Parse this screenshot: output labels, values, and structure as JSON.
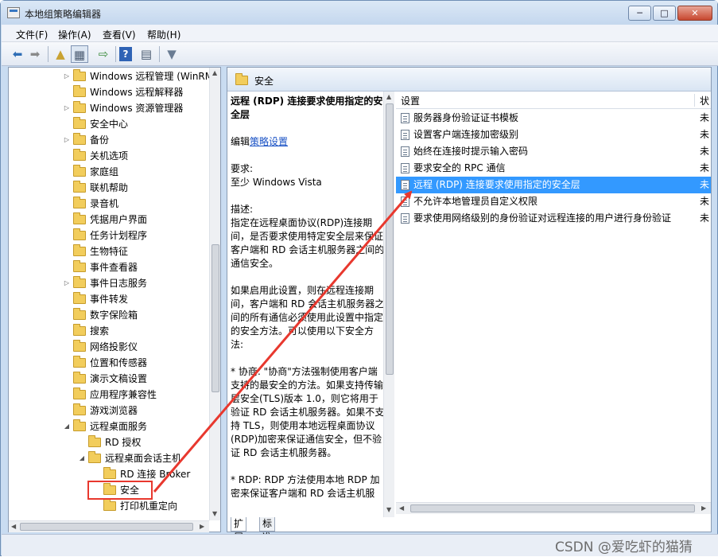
{
  "window": {
    "title": "本地组策略编辑器",
    "buttons": [
      "─",
      "□",
      "✕"
    ]
  },
  "menu": [
    "文件(F)",
    "操作(A)",
    "查看(V)",
    "帮助(H)"
  ],
  "toolbar_icons": [
    "back-arrow-icon",
    "forward-arrow-icon",
    "up-folder-icon",
    "show-hide-tree-icon",
    "export-list-icon",
    "help-icon",
    "properties-icon",
    "filter-icon"
  ],
  "tree": {
    "items": [
      {
        "label": "Windows 远程管理 (WinRM",
        "level": 1,
        "expandable": true
      },
      {
        "label": "Windows 远程解释器",
        "level": 1,
        "expandable": false
      },
      {
        "label": "Windows 资源管理器",
        "level": 1,
        "expandable": true
      },
      {
        "label": "安全中心",
        "level": 1,
        "expandable": false
      },
      {
        "label": "备份",
        "level": 1,
        "expandable": true
      },
      {
        "label": "关机选项",
        "level": 1,
        "expandable": false
      },
      {
        "label": "家庭组",
        "level": 1,
        "expandable": false
      },
      {
        "label": "联机帮助",
        "level": 1,
        "expandable": false
      },
      {
        "label": "录音机",
        "level": 1,
        "expandable": false
      },
      {
        "label": "凭据用户界面",
        "level": 1,
        "expandable": false
      },
      {
        "label": "任务计划程序",
        "level": 1,
        "expandable": false
      },
      {
        "label": "生物特征",
        "level": 1,
        "expandable": false
      },
      {
        "label": "事件查看器",
        "level": 1,
        "expandable": false
      },
      {
        "label": "事件日志服务",
        "level": 1,
        "expandable": true
      },
      {
        "label": "事件转发",
        "level": 1,
        "expandable": false
      },
      {
        "label": "数字保险箱",
        "level": 1,
        "expandable": false
      },
      {
        "label": "搜索",
        "level": 1,
        "expandable": false
      },
      {
        "label": "网络投影仪",
        "level": 1,
        "expandable": false
      },
      {
        "label": "位置和传感器",
        "level": 1,
        "expandable": false
      },
      {
        "label": "演示文稿设置",
        "level": 1,
        "expandable": false
      },
      {
        "label": "应用程序兼容性",
        "level": 1,
        "expandable": false
      },
      {
        "label": "游戏浏览器",
        "level": 1,
        "expandable": false
      },
      {
        "label": "远程桌面服务",
        "level": 1,
        "expandable": true,
        "expanded": true
      },
      {
        "label": "RD 授权",
        "level": 2,
        "expandable": false
      },
      {
        "label": "远程桌面会话主机",
        "level": 2,
        "expandable": true,
        "expanded": true
      },
      {
        "label": "RD 连接 Broker",
        "level": 3,
        "expandable": false
      },
      {
        "label": "安全",
        "level": 3,
        "expandable": false,
        "selected": true
      },
      {
        "label": "打印机重定向",
        "level": 3,
        "expandable": false
      }
    ]
  },
  "right": {
    "header": "安全",
    "description": {
      "title": "远程 (RDP) 连接要求使用指定的安全层",
      "edit_prefix": "编辑",
      "edit_link": "策略设置",
      "req_label": "要求:",
      "req_value": "至少 Windows Vista",
      "desc_label": "描述:",
      "p1": "指定在远程桌面协议(RDP)连接期间，是否要求使用特定安全层来保证客户端和 RD 会话主机服务器之间的通信安全。",
      "p2": "如果启用此设置，则在远程连接期间，客户端和 RD 会话主机服务器之间的所有通信必须使用此设置中指定的安全方法。可以使用以下安全方法:",
      "p3": "* 协商: \"协商\"方法强制使用客户端支持的最安全的方法。如果支持传输层安全(TLS)版本 1.0，则它将用于验证 RD 会话主机服务器。如果不支持 TLS，则使用本地远程桌面协议(RDP)加密来保证通信安全，但不验证 RD 会话主机服务器。",
      "p4": "* RDP: RDP 方法使用本地 RDP 加密来保证客户端和 RD 会话主机服"
    },
    "columns": [
      "设置",
      "状"
    ],
    "rows": [
      {
        "name": "服务器身份验证证书模板",
        "state": "未"
      },
      {
        "name": "设置客户端连接加密级别",
        "state": "未"
      },
      {
        "name": "始终在连接时提示输入密码",
        "state": "未"
      },
      {
        "name": "要求安全的 RPC 通信",
        "state": "未"
      },
      {
        "name": "远程 (RDP) 连接要求使用指定的安全层",
        "state": "未",
        "selected": true
      },
      {
        "name": "不允许本地管理员自定义权限",
        "state": "未"
      },
      {
        "name": "要求使用网络级别的身份验证对远程连接的用户进行身份验证",
        "state": "未"
      }
    ],
    "tabs": [
      "扩展",
      "标准"
    ]
  },
  "watermark": "CSDN @爱吃虾的猫猜",
  "colors": {
    "selection": "#3399ff",
    "annotation": "#e8382e",
    "link": "#1a52c5"
  }
}
